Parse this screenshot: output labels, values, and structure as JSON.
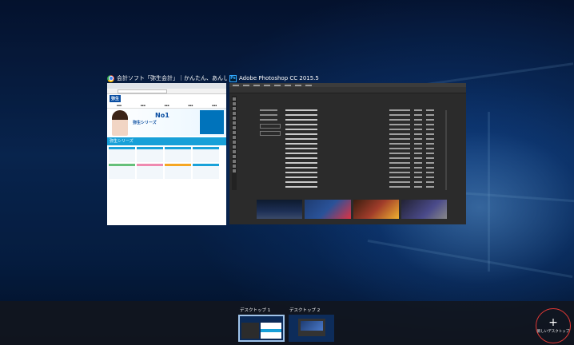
{
  "windows": [
    {
      "id": "yayoi",
      "title": "会計ソフト「弥生会計」｜かんたん、あんしん、たよれる、会...",
      "icon": "chrome-icon"
    },
    {
      "id": "photoshop",
      "title": "Adobe Photoshop CC 2015.5",
      "icon": "photoshop-icon",
      "icon_text": "Ps"
    }
  ],
  "desktops": {
    "items": [
      {
        "label": "デスクトップ 1",
        "active": true
      },
      {
        "label": "デスクトップ 2",
        "active": false
      }
    ],
    "new_desktop": {
      "icon": "plus-icon",
      "symbol": "+",
      "label": "新しいデスクトップ"
    }
  },
  "colors": {
    "accent_ring": "#e53935",
    "active_desktop_border": "#9fc3ea"
  }
}
